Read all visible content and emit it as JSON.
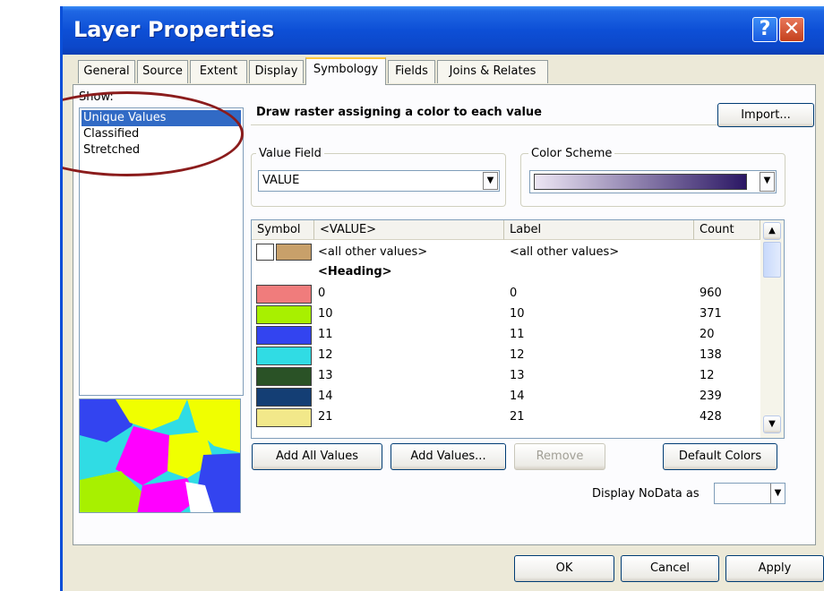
{
  "window": {
    "title": "Layer Properties",
    "help_glyph": "?",
    "close_glyph": "✕"
  },
  "tabs": [
    {
      "label": "General"
    },
    {
      "label": "Source"
    },
    {
      "label": "Extent"
    },
    {
      "label": "Display"
    },
    {
      "label": "Symbology",
      "selected": true
    },
    {
      "label": "Fields"
    },
    {
      "label": "Joins & Relates"
    }
  ],
  "show": {
    "label": "Show:",
    "items": [
      {
        "label": "Unique Values",
        "selected": true
      },
      {
        "label": "Classified"
      },
      {
        "label": "Stretched"
      }
    ]
  },
  "header": {
    "description": "Draw raster assigning a color to each value",
    "import_label": "Import..."
  },
  "value_field": {
    "label": "Value Field",
    "value": "VALUE"
  },
  "color_scheme": {
    "label": "Color Scheme",
    "gradient_from": "#ede6f4",
    "gradient_to": "#2b1764"
  },
  "table": {
    "columns": [
      "Symbol",
      "<VALUE>",
      "Label",
      "Count"
    ],
    "other_row": {
      "value": "<all other values>",
      "label": "<all other values>",
      "color": "#c8a06a"
    },
    "heading": "<Heading>",
    "rows": [
      {
        "value": "0",
        "label": "0",
        "count": "960",
        "color": "#f07c7c"
      },
      {
        "value": "10",
        "label": "10",
        "count": "371",
        "color": "#a8f000"
      },
      {
        "value": "11",
        "label": "11",
        "count": "20",
        "color": "#3344f0"
      },
      {
        "value": "12",
        "label": "12",
        "count": "138",
        "color": "#30dce4"
      },
      {
        "value": "13",
        "label": "13",
        "count": "12",
        "color": "#2a5226"
      },
      {
        "value": "14",
        "label": "14",
        "count": "239",
        "color": "#143e74"
      },
      {
        "value": "21",
        "label": "21",
        "count": "428",
        "color": "#f2e88a"
      }
    ]
  },
  "buttons": {
    "add_all": "Add All Values",
    "add_values": "Add Values...",
    "remove": "Remove",
    "default_colors": "Default Colors",
    "ok": "OK",
    "cancel": "Cancel",
    "apply": "Apply"
  },
  "nodata": {
    "label": "Display NoData as"
  }
}
